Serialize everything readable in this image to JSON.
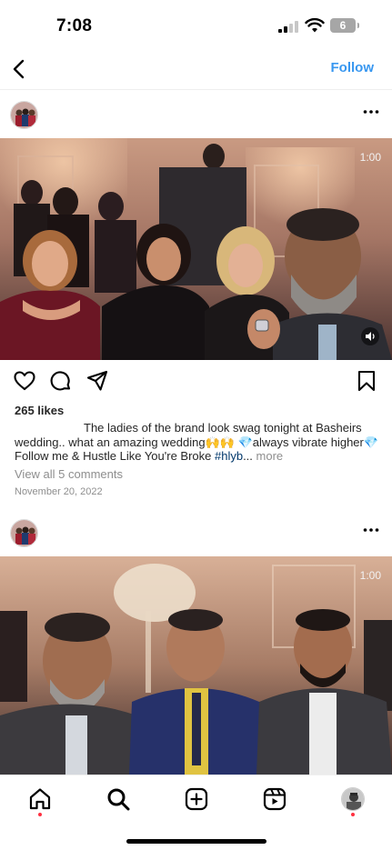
{
  "status_bar": {
    "time": "7:08",
    "battery": "6"
  },
  "header": {
    "follow_label": "Follow"
  },
  "post1": {
    "duration": "1:00",
    "likes": "265 likes",
    "caption_part1": "The ladies of the brand look swag tonight at Basheirs wedding.. what an amazing wedding🙌🙌 💎always vibrate higher💎 Follow me & Hustle Like You're Broke ",
    "hashtag": "#hlyb",
    "ellipsis": "...",
    "more": " more",
    "view_comments": "View all 5 comments",
    "date": "November 20, 2022"
  },
  "post2": {
    "duration": "1:00"
  },
  "icons": {
    "back": "chevron-left-icon",
    "more": "more-horizontal-icon",
    "like": "heart-icon",
    "comment": "comment-icon",
    "share": "paper-plane-icon",
    "save": "bookmark-icon",
    "home": "home-icon",
    "search": "search-icon",
    "create": "plus-square-icon",
    "reels": "reels-icon",
    "profile": "profile-avatar"
  },
  "colors": {
    "accent": "#3897f0",
    "notification": "#ff3040",
    "hashtag": "#00376b",
    "muted": "#8e8e8e"
  }
}
